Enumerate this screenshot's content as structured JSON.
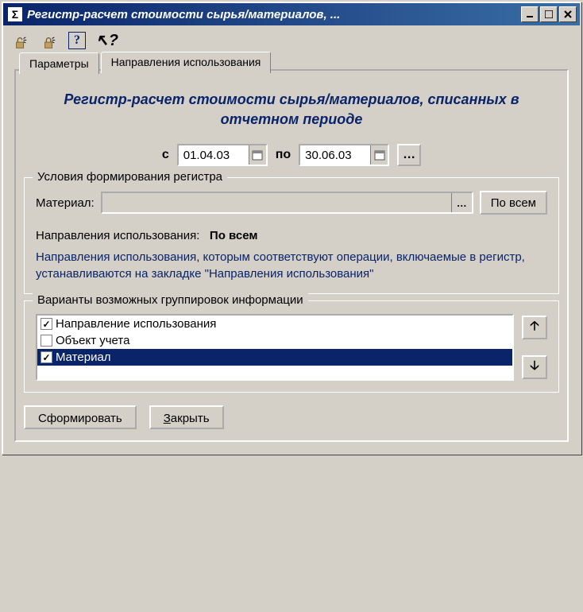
{
  "window": {
    "title": "Регистр-расчет стоимости сырья/материалов, ..."
  },
  "tabs": {
    "parameters": "Параметры",
    "directions": "Направления использования"
  },
  "heading": "Регистр-расчет стоимости сырья/материалов, списанных в отчетном периоде",
  "dates": {
    "from_label": "с",
    "from_value": "01.04.03",
    "to_label": "по",
    "to_value": "30.06.03"
  },
  "conditions": {
    "legend": "Условия формирования регистра",
    "material_label": "Материал:",
    "material_value": "",
    "all_button": "По всем",
    "direction_label": "Направления использования:",
    "direction_value": "По всем",
    "help_text": "Направления использования, которым соответствуют операции, включаемые в регистр, устанавливаются на закладке \"Направления использования\""
  },
  "groupings": {
    "legend": "Варианты возможных группировок информации",
    "items": [
      {
        "label": "Направление использования",
        "checked": true,
        "selected": false
      },
      {
        "label": "Объект учета",
        "checked": false,
        "selected": false
      },
      {
        "label": "Материал",
        "checked": true,
        "selected": true
      }
    ]
  },
  "buttons": {
    "generate": "Сформировать",
    "close_u": "З",
    "close_rest": "акрыть"
  }
}
